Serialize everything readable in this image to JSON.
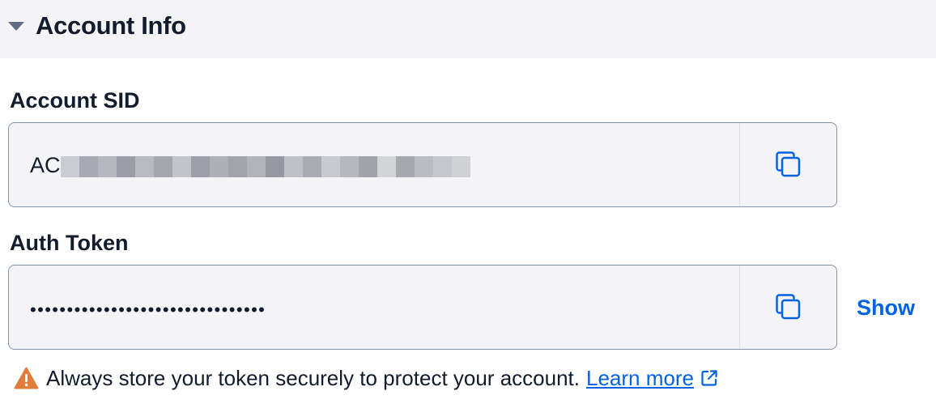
{
  "section": {
    "title": "Account Info"
  },
  "account_sid": {
    "label": "Account SID",
    "value_prefix": "AC",
    "value_redacted": true
  },
  "auth_token": {
    "label": "Auth Token",
    "masked_value": "••••••••••••••••••••••••••••••••",
    "show_label": "Show"
  },
  "warning": {
    "text": "Always store your token securely to protect your account.",
    "link_label": "Learn more"
  },
  "icons": {
    "caret": "caret-down-icon",
    "copy": "copy-icon",
    "warning": "warning-icon",
    "external": "external-link-icon"
  },
  "colors": {
    "link": "#0263e0",
    "warning": "#e07b39",
    "field_bg": "#f4f4f6",
    "field_border": "#8891aa"
  }
}
